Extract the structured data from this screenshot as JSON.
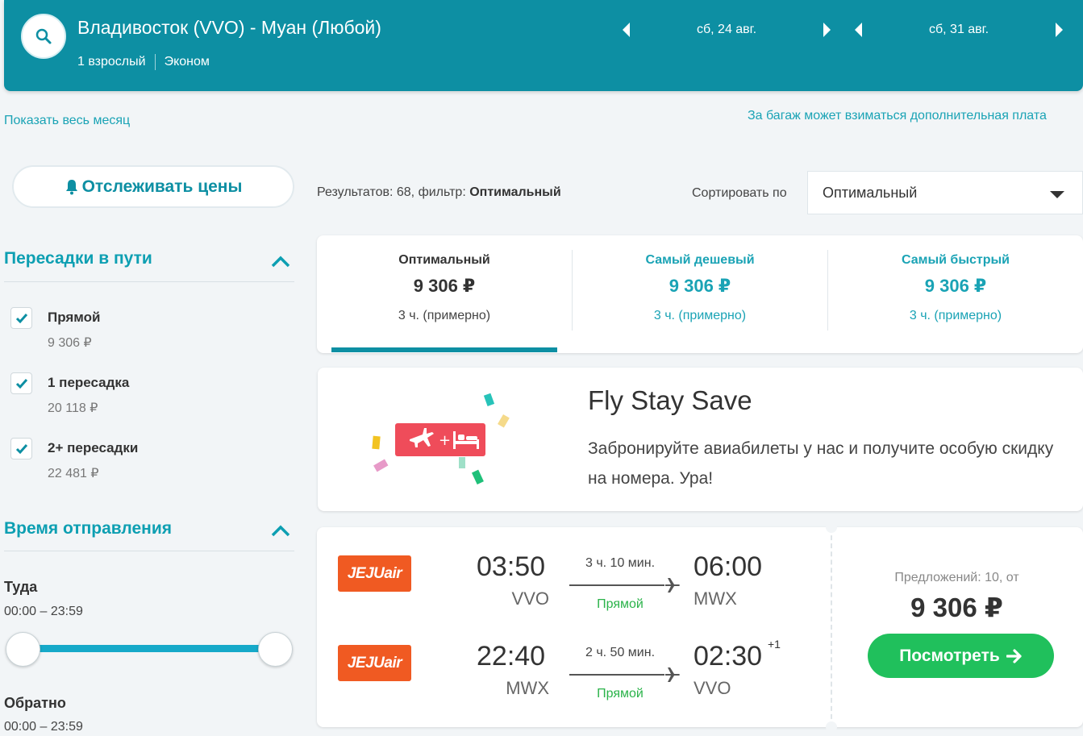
{
  "header": {
    "route": "Владивосток (VVO) - Муан (Любой)",
    "passengers": "1 взрослый",
    "cabin": "Эконом",
    "depart_date": "сб, 24 авг.",
    "return_date": "сб, 31 авг."
  },
  "links": {
    "show_month": "Показать весь месяц",
    "baggage_note": "За багаж может взиматься дополнительная плата"
  },
  "sidebar": {
    "track_label": "Отслеживать цены",
    "stops_title": "Пересадки в пути",
    "stops": [
      {
        "label": "Прямой",
        "price": "9 306 ₽",
        "checked": true
      },
      {
        "label": "1 пересадка",
        "price": "20 118 ₽",
        "checked": true
      },
      {
        "label": "2+ пересадки",
        "price": "22 481 ₽",
        "checked": true
      }
    ],
    "time_title": "Время отправления",
    "outbound_label": "Туда",
    "outbound_range": "00:00 – 23:59",
    "return_label": "Обратно",
    "return_range": "00:00 – 23:59"
  },
  "results": {
    "prefix": "Результатов: 68, фильтр: ",
    "filter": "Оптимальный",
    "sort_label": "Сортировать по",
    "sort_value": "Оптимальный"
  },
  "tabs": [
    {
      "title": "Оптимальный",
      "price": "9 306 ₽",
      "duration": "3 ч. (примерно)",
      "active": true
    },
    {
      "title": "Самый дешевый",
      "price": "9 306 ₽",
      "duration": "3 ч. (примерно)",
      "active": false
    },
    {
      "title": "Самый быстрый",
      "price": "9 306 ₽",
      "duration": "3 ч. (примерно)",
      "active": false
    }
  ],
  "promo": {
    "title": "Fly Stay Save",
    "text": "Забронируйте авиабилеты у нас и получите особую скидку на номера. Ура!"
  },
  "flight": {
    "airline_logo_text": "JEJUair",
    "legs": [
      {
        "dep_time": "03:50",
        "dep_code": "VVO",
        "duration": "3 ч. 10 мин.",
        "stops": "Прямой",
        "arr_time": "06:00",
        "arr_code": "MWX",
        "day_offset": ""
      },
      {
        "dep_time": "22:40",
        "dep_code": "MWX",
        "duration": "2 ч. 50 мин.",
        "stops": "Прямой",
        "arr_time": "02:30",
        "arr_code": "VVO",
        "day_offset": "+1"
      }
    ],
    "offers": "Предложений: 10, от",
    "price": "9 306 ₽",
    "view_label": "Посмотреть"
  },
  "colors": {
    "brand": "#0d8fa3",
    "accent_text": "#1aa3b5",
    "direct_green": "#2bb34a",
    "cta_green": "#20c05c",
    "jeju_orange": "#f05a22"
  }
}
